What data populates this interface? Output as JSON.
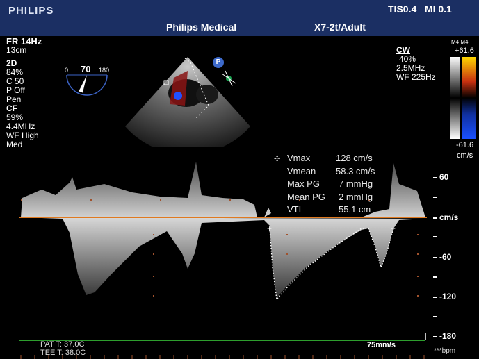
{
  "header": {
    "brand": "PHILIPS",
    "indices": "TIS0.4   MI 0.1",
    "facility": "Philips Medical",
    "probe_preset": "X7-2t/Adult"
  },
  "left_panel": {
    "fr": "FR 14Hz",
    "depth": "13cm",
    "mode_2d": "2D",
    "gain_2d": "84%",
    "compress": "C 50",
    "persist": "P Off",
    "preset": "Pen",
    "mode_cf": "CF",
    "gain_cf": "59%",
    "freq_cf": "4.4MHz",
    "wf_cf": "WF High",
    "cf_level": "Med"
  },
  "angle": {
    "min": "0",
    "value": "70",
    "max": "180",
    "rotation_deg": 70
  },
  "cw_panel": {
    "mode": "CW",
    "gain": "40%",
    "freq": "2.5MHz",
    "wf": "WF 225Hz"
  },
  "color_scale": {
    "label": "M4 M4",
    "top": "+61.6",
    "bottom": "-61.6",
    "unit": "cm/s",
    "top_color": "#ffd800",
    "bottom_color": "#1a50ff"
  },
  "measurements": [
    {
      "label": "Vmax",
      "value": "128 cm/s"
    },
    {
      "label": "Vmean",
      "value": "58.3 cm/s"
    },
    {
      "label": "Max PG",
      "value": "7 mmHg"
    },
    {
      "label": "Mean PG",
      "value": "2 mmHg"
    },
    {
      "label": "VTI",
      "value": "55.1 cm"
    }
  ],
  "velocity_scale": {
    "labels": [
      "60",
      "cm/s",
      "-60",
      "-120",
      "-180"
    ],
    "baseline_color": "#e07a20"
  },
  "footer": {
    "pat_temp": "PAT T: 37.0C",
    "tee_temp": "TEE T: 38.0C",
    "sweep_speed": "75mm/s",
    "heart_rate": "***bpm",
    "ecg_color": "#3cd23c"
  },
  "icons": {
    "probe_badge": "P"
  }
}
